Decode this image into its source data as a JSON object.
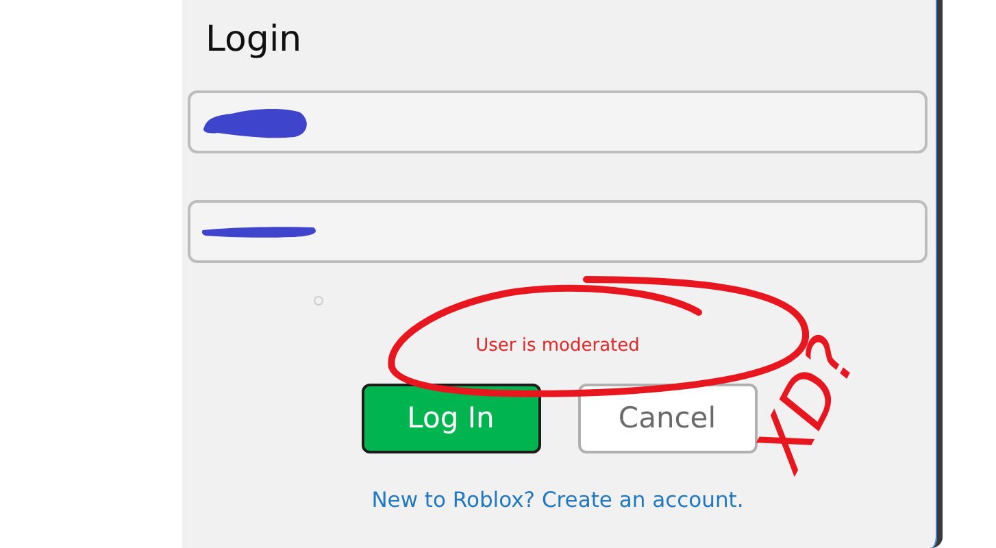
{
  "dialog": {
    "title": "Login",
    "fields": [
      {
        "redacted": true
      },
      {
        "redacted": true
      }
    ],
    "error": "User is moderated",
    "buttons": [
      {
        "label": "Log In",
        "kind": "primary"
      },
      {
        "label": "Cancel",
        "kind": "secondary"
      }
    ],
    "signup_link": "New to Roblox? Create an account."
  },
  "annotations": {
    "error_circled": true,
    "note": "XD?"
  }
}
